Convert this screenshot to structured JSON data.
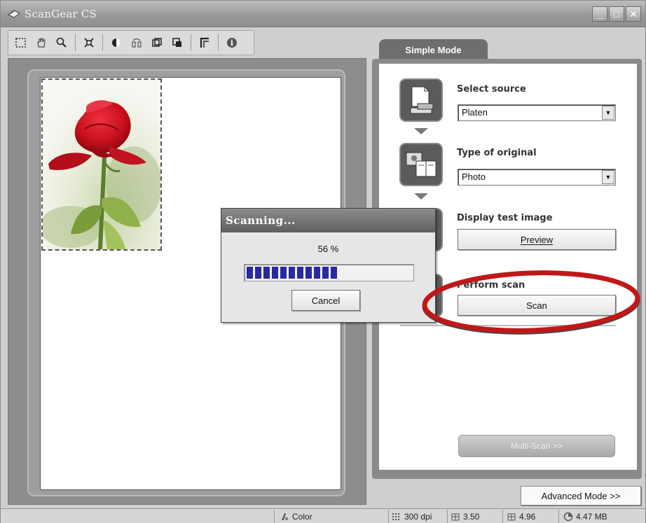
{
  "window": {
    "title": "ScanGear CS",
    "icons": [
      "scanner-app-icon",
      "minimize-icon",
      "maximize-icon",
      "close-icon"
    ]
  },
  "toolbar": {
    "icons": [
      "marquee-select-icon",
      "hand-pan-icon",
      "zoom-icon",
      "auto-crop-icon",
      "invert-icon",
      "mirror-icon",
      "rotate-left-icon",
      "rotate-right-icon",
      "crop-frame-icon",
      "info-icon"
    ]
  },
  "preview": {
    "image": "red-rose-photo"
  },
  "panel": {
    "tab_label": "Simple Mode",
    "steps": [
      {
        "label": "Select source",
        "value": "Platen",
        "icon": "platen-icon"
      },
      {
        "label": "Type of original",
        "value": "Photo",
        "icon": "photo-original-icon"
      },
      {
        "label": "Display test image",
        "button": "Preview"
      },
      {
        "label": "Perform scan",
        "button": "Scan"
      }
    ],
    "multiscan_label": "Multi-Scan >>",
    "advanced_label": "Advanced Mode >>"
  },
  "statusbar": {
    "color_mode": "Color",
    "resolution": "300 dpi",
    "width": "3.50",
    "height": "4.96",
    "size": "4.47 MB"
  },
  "dialog": {
    "title": "Scanning...",
    "percent_text": "56 %",
    "progress": 0.56,
    "cancel_label": "Cancel"
  },
  "colors": {
    "progress_block": "#2a2aa0",
    "annotation": "#c01818",
    "panel_dark": "#5b5b5b"
  }
}
